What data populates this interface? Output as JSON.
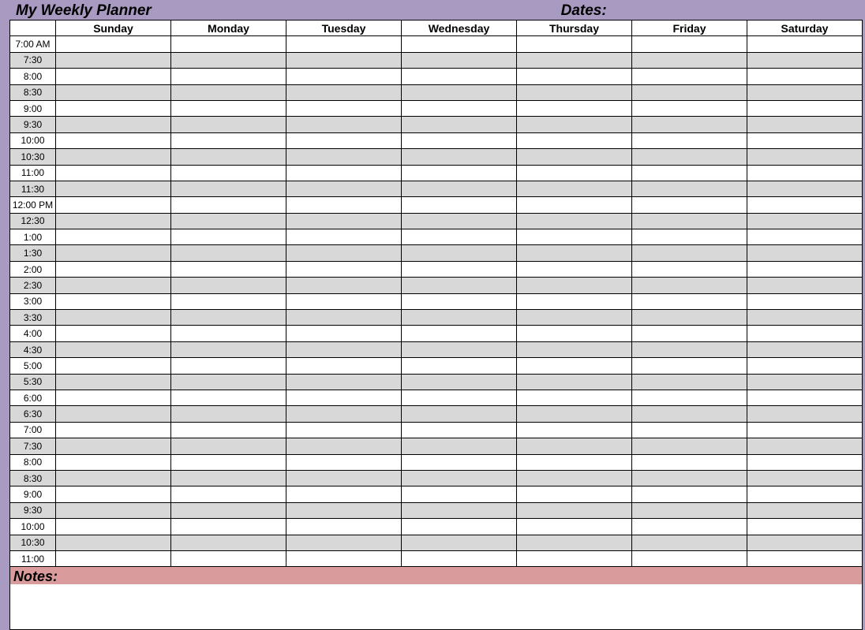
{
  "header": {
    "title": "My Weekly Planner",
    "dates_label": "Dates:"
  },
  "days": [
    "Sunday",
    "Monday",
    "Tuesday",
    "Wednesday",
    "Thursday",
    "Friday",
    "Saturday"
  ],
  "times": [
    "7:00 AM",
    "7:30",
    "8:00",
    "8:30",
    "9:00",
    "9:30",
    "10:00",
    "10:30",
    "11:00",
    "11:30",
    "12:00 PM",
    "12:30",
    "1:00",
    "1:30",
    "2:00",
    "2:30",
    "3:00",
    "3:30",
    "4:00",
    "4:30",
    "5:00",
    "5:30",
    "6:00",
    "6:30",
    "7:00",
    "7:30",
    "8:00",
    "8:30",
    "9:00",
    "9:30",
    "10:00",
    "10:30",
    "11:00"
  ],
  "notes_label": "Notes:"
}
